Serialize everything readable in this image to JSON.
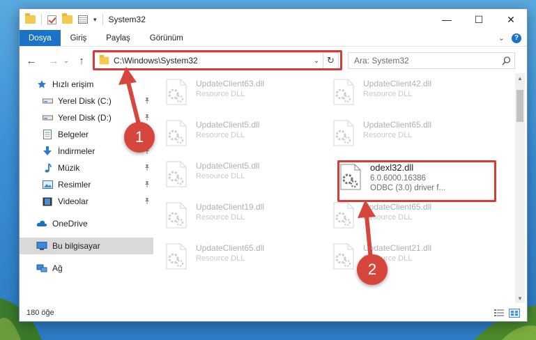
{
  "window": {
    "title": "System32",
    "controls": {
      "minimize": "—",
      "maximize": "☐",
      "close": "✕"
    }
  },
  "ribbon": {
    "tabs": [
      "Dosya",
      "Giriş",
      "Paylaş",
      "Görünüm"
    ],
    "expand_glyph": "⌄",
    "help_glyph": "?"
  },
  "nav": {
    "back_glyph": "←",
    "forward_glyph": "→",
    "recent_glyph": "⌄",
    "up_glyph": "↑",
    "address_path": "C:\\Windows\\System32",
    "address_dropdown_glyph": "⌄",
    "refresh_glyph": "↻",
    "search_placeholder": "Ara: System32"
  },
  "sidebar": {
    "items": [
      {
        "label": "Hızlı erişim",
        "icon": "star-icon",
        "pinned": false
      },
      {
        "label": "Yerel Disk (C:)",
        "icon": "drive-icon",
        "pinned": true
      },
      {
        "label": "Yerel Disk (D:)",
        "icon": "drive-icon",
        "pinned": true
      },
      {
        "label": "Belgeler",
        "icon": "document-icon",
        "pinned": true
      },
      {
        "label": "İndirmeler",
        "icon": "download-icon",
        "pinned": true
      },
      {
        "label": "Müzik",
        "icon": "music-icon",
        "pinned": true
      },
      {
        "label": "Resimler",
        "icon": "pictures-icon",
        "pinned": true
      },
      {
        "label": "Videolar",
        "icon": "video-icon",
        "pinned": true
      },
      {
        "label": "OneDrive",
        "icon": "cloud-icon",
        "pinned": false
      },
      {
        "label": "Bu bilgisayar",
        "icon": "computer-icon",
        "pinned": false,
        "selected": true
      },
      {
        "label": "Ağ",
        "icon": "network-icon",
        "pinned": false
      }
    ]
  },
  "files": [
    {
      "name": "UpdateClient63.dll",
      "desc": "Resource DLL",
      "version": ""
    },
    {
      "name": "UpdateClient42.dll",
      "desc": "Resource DLL",
      "version": ""
    },
    {
      "name": "UpdateClient5.dll",
      "desc": "Resource DLL",
      "version": ""
    },
    {
      "name": "UpdateClient65.dll",
      "desc": "Resource DLL",
      "version": ""
    },
    {
      "name": "UpdateClient5.dll",
      "desc": "Resource DLL",
      "version": ""
    },
    {
      "name": "odexl32.dll",
      "desc": "ODBC (3.0) driver f...",
      "version": "6.0.6000.16386"
    },
    {
      "name": "UpdateClient19.dll",
      "desc": "Resource DLL",
      "version": ""
    },
    {
      "name": "UpdateClient65.dll",
      "desc": "Resource DLL",
      "version": ""
    },
    {
      "name": "UpdateClient65.dll",
      "desc": "Resource DLL",
      "version": ""
    },
    {
      "name": "UpdateClient21.dll",
      "desc": "Resource DLL",
      "version": ""
    }
  ],
  "status": {
    "count": "180 öğe"
  },
  "annotations": {
    "step1": "1",
    "step2": "2",
    "accent_color": "#d6463c"
  },
  "colors": {
    "file_tab": "#1a73c7",
    "selected_sidebar": "#d9d9d9",
    "highlight": "#d63a3a"
  }
}
